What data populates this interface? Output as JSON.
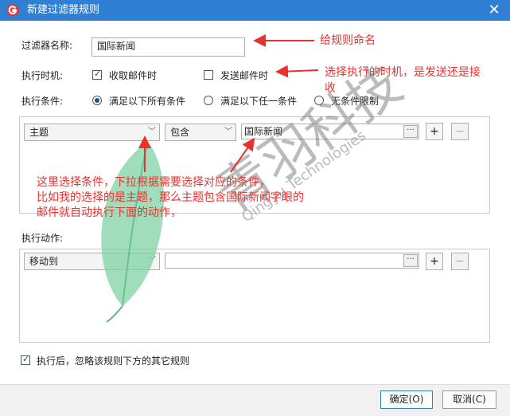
{
  "window": {
    "title": "新建过滤器规则",
    "close_label": "✕"
  },
  "name_row": {
    "label": "过滤器名称:",
    "value": "国际新闻"
  },
  "timing_row": {
    "label": "执行时机:",
    "option_receive": "收取邮件时",
    "option_send": "发送邮件时",
    "receive_checked": true,
    "send_checked": false
  },
  "condition_row": {
    "label": "执行条件:",
    "options": [
      "满足以下所有条件",
      "满足以下任一条件",
      "无条件限制"
    ],
    "selected": 0
  },
  "condition_editor": {
    "field": "主题",
    "operator": "包含",
    "value": "国际新闻",
    "ellipsis": "···",
    "add": "+",
    "remove": "−"
  },
  "actions": {
    "label": "执行动作:",
    "action": "移动到",
    "target": "",
    "ellipsis": "···",
    "add": "+",
    "remove": "−"
  },
  "ignore_option": {
    "label": "执行后，忽略该规则下方的其它规则",
    "checked": true
  },
  "footer": {
    "ok": "确定(O)",
    "cancel": "取消(C)"
  },
  "annotations": {
    "name_hint": "给规则命名",
    "timing_hint_1": "选择执行的时机，是发送还是接",
    "timing_hint_2": "收",
    "condition_hint_1": "这里选择条件，下拉根据需要选择对应的条件，",
    "condition_hint_2": "比如我的选择的是主题，那么主题包含国际新闻字眼的",
    "condition_hint_3": "邮件就自动执行下面的动作，"
  },
  "watermark": {
    "cn": "青羽科技",
    "en": "Qingyu Technologies"
  },
  "colors": {
    "titlebar": "#2f7fd4",
    "annotation": "#e8322f",
    "feather": "#7fd1a4"
  }
}
